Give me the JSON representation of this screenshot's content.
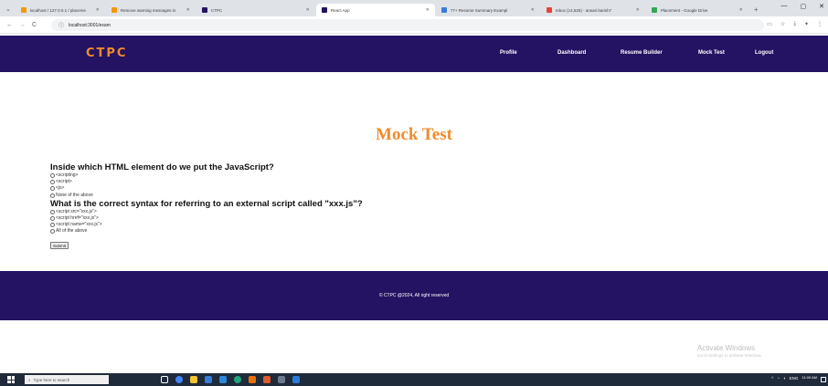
{
  "browser": {
    "tabs": [
      {
        "label": "localhost / 127.0.0.1 / placeme",
        "color": "#f29900"
      },
      {
        "label": "Remove warning messages in",
        "color": "#f29900"
      },
      {
        "label": "CTPC",
        "color": "#241263"
      },
      {
        "label": "React App",
        "color": "#241263",
        "active": true
      },
      {
        "label": "77+ Resume Summary Exampl",
        "color": "#3a7bd5"
      },
      {
        "label": "Inbox (14,525) - ansari.barish7",
        "color": "#ea4335"
      },
      {
        "label": "Placement - Google Drive",
        "color": "#34a853"
      }
    ],
    "url": "localhost:3001/exam",
    "nav": {
      "back": "←",
      "forward": "→",
      "reload": "C"
    }
  },
  "navbar": {
    "brand": "CTPC",
    "links": [
      "Profile",
      "Dashboard",
      "Resume Builder",
      "Mock Test",
      "Logout"
    ]
  },
  "main": {
    "title": "Mock Test",
    "questions": [
      {
        "text": "Inside which HTML element do we put the JavaScript?",
        "options": [
          "<scripting>",
          "<script>",
          "<js>",
          "None of the above"
        ]
      },
      {
        "text": "What is the correct syntax for referring to an external script called \"xxx.js\"?",
        "options": [
          "<script src=\"xxx.js\">",
          "<script href=\"xxx.js\">",
          "<script name=\"xxx.js\">",
          "All of the above"
        ]
      }
    ],
    "submit_label": "Submit"
  },
  "footer": {
    "text": "© CTPC @2024, All right reserved"
  },
  "watermark": {
    "title": "Activate Windows",
    "subtitle": "Go to Settings to activate Windows."
  },
  "taskbar": {
    "search_placeholder": "Type here to search",
    "clock_time": "11:09 AM",
    "lang": "ENG"
  }
}
